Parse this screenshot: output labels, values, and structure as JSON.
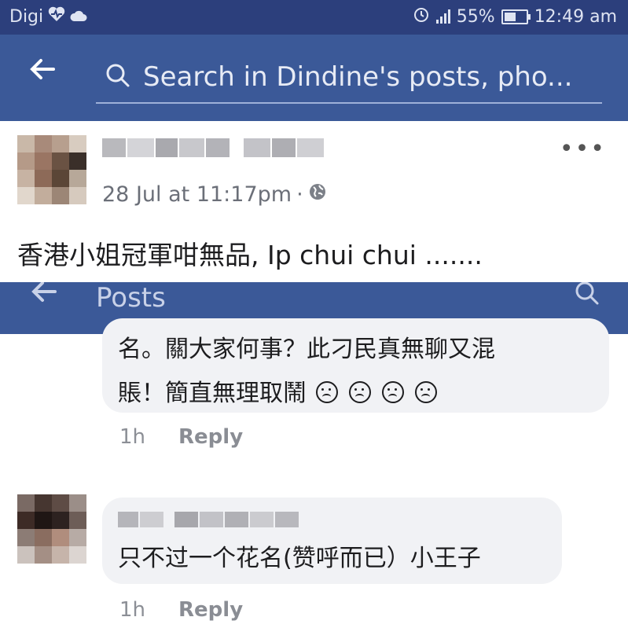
{
  "status_bar": {
    "carrier": "Digi",
    "battery": "55%",
    "battery_level": 0.55,
    "time": "12:49 am"
  },
  "search_bar": {
    "back_icon": "back-arrow-icon",
    "search_icon": "search-icon",
    "placeholder": "Search in Dindine's posts, pho..."
  },
  "post": {
    "timestamp": "28 Jul at 11:17pm",
    "separator": "·",
    "privacy_icon": "globe-icon",
    "text": "香港小姐冠軍咁無品, Ip chui chui .......",
    "more_icon": "more-dots-icon"
  },
  "posts_header": {
    "title": "Posts",
    "back_icon": "back-arrow-icon",
    "search_icon": "search-icon"
  },
  "comments": [
    {
      "lines": [
        "名。關大家何事？此刁民真無聊又混",
        "賬！簡直無理取鬧"
      ],
      "emoji_icon": "angry-face-icon",
      "time": "1h",
      "reply_label": "Reply"
    },
    {
      "text": "只不过一个花名(赞呼而已）小王子",
      "time": "1h",
      "reply_label": "Reply"
    }
  ],
  "colors": {
    "status_bar": "#2c3f7c",
    "header_blue": "#3b5998",
    "bubble_gray": "#f1f2f5"
  }
}
